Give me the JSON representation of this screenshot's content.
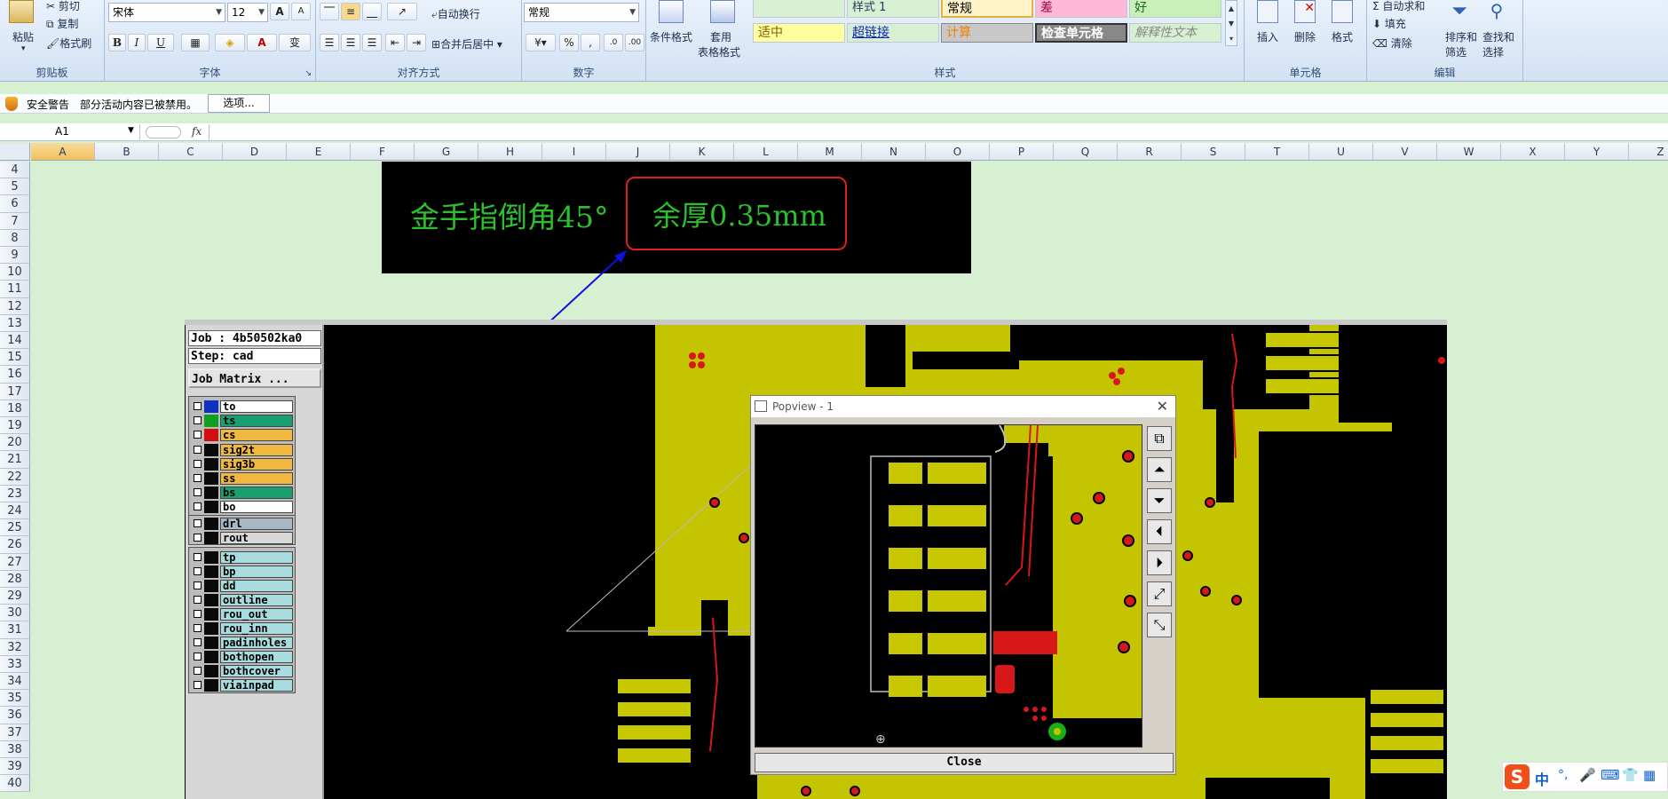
{
  "ribbon": {
    "clipboard": {
      "paste": "粘贴",
      "cut": "剪切",
      "copy": "复制",
      "format_painter": "格式刷",
      "group": "剪贴板"
    },
    "font": {
      "name": "宋体",
      "size": "12",
      "bold": "B",
      "italic": "I",
      "underline": "U",
      "phonetic": "变",
      "group": "字体"
    },
    "align": {
      "wrap": "自动换行",
      "merge": "合并后居中",
      "group": "对齐方式"
    },
    "number": {
      "format": "常规",
      "percent": "%",
      "comma": ",",
      "group": "数字"
    },
    "styles": {
      "cond_format": "条件格式",
      "table_format_1": "套用",
      "table_format_2": "表格格式",
      "cells": [
        "样式 1",
        "常规",
        "差",
        "好",
        "适中",
        "超链接",
        "计算",
        "检查单元格",
        "解释性文本"
      ],
      "group": "样式"
    },
    "cells": {
      "insert": "插入",
      "delete": "删除",
      "format": "格式",
      "group": "单元格"
    },
    "editing": {
      "autosum": "自动求和",
      "fill": "填充",
      "clear": "清除",
      "sort_1": "排序和",
      "sort_2": "筛选",
      "find_1": "查找和",
      "find_2": "选择",
      "group": "编辑"
    }
  },
  "security": {
    "title": "安全警告",
    "message": "部分活动内容已被禁用。",
    "options": "选项..."
  },
  "formula_bar": {
    "cell": "A1",
    "fx": "fx"
  },
  "columns": [
    "A",
    "B",
    "C",
    "D",
    "E",
    "F",
    "G",
    "H",
    "I",
    "J",
    "K",
    "L",
    "M",
    "N",
    "O",
    "P",
    "Q",
    "R",
    "S",
    "T",
    "U",
    "V",
    "W",
    "X",
    "Y",
    "Z"
  ],
  "rows": [
    "4",
    "5",
    "6",
    "7",
    "8",
    "9",
    "10",
    "11",
    "12",
    "13",
    "14",
    "15",
    "16",
    "17",
    "18",
    "19",
    "20",
    "21",
    "22",
    "23",
    "24",
    "25",
    "26",
    "27",
    "28",
    "29",
    "30",
    "31",
    "32",
    "33",
    "34",
    "35",
    "36",
    "37",
    "38",
    "39",
    "40"
  ],
  "annotation": {
    "text1": "金手指倒角45°",
    "text2": "余厚0.35mm"
  },
  "cam": {
    "job": "Job : 4b50502ka0",
    "step": "Step: cad",
    "matrix": "Job Matrix ...",
    "layers": [
      {
        "name": "to",
        "color": "#ffffff",
        "swatch": "#1030c0"
      },
      {
        "name": "ts",
        "color": "#1aa070",
        "swatch": "#10a020"
      },
      {
        "name": "cs",
        "color": "#f0b840",
        "swatch": "#d01010"
      },
      {
        "name": "sig2t",
        "color": "#f0b840",
        "swatch": "#0a0a0a"
      },
      {
        "name": "sig3b",
        "color": "#f0b840",
        "swatch": "#0a0a0a"
      },
      {
        "name": "ss",
        "color": "#f0b840",
        "swatch": "#0a0a0a"
      },
      {
        "name": "bs",
        "color": "#1aa070",
        "swatch": "#0a0a0a"
      },
      {
        "name": "bo",
        "color": "#ffffff",
        "swatch": "#0a0a0a"
      }
    ],
    "drill_layers": [
      {
        "name": "drl",
        "color": "#a8b8c4"
      },
      {
        "name": "rout",
        "color": "#d8d8d8"
      }
    ],
    "doc_layers": [
      "tp",
      "bp",
      "dd",
      "outline",
      "rou_out",
      "rou_inn",
      "padinholes",
      "bothopen",
      "bothcover",
      "viainpad"
    ]
  },
  "popview": {
    "title": "Popview - 1",
    "close": "Close"
  },
  "taskbar": {
    "ime": "中"
  }
}
